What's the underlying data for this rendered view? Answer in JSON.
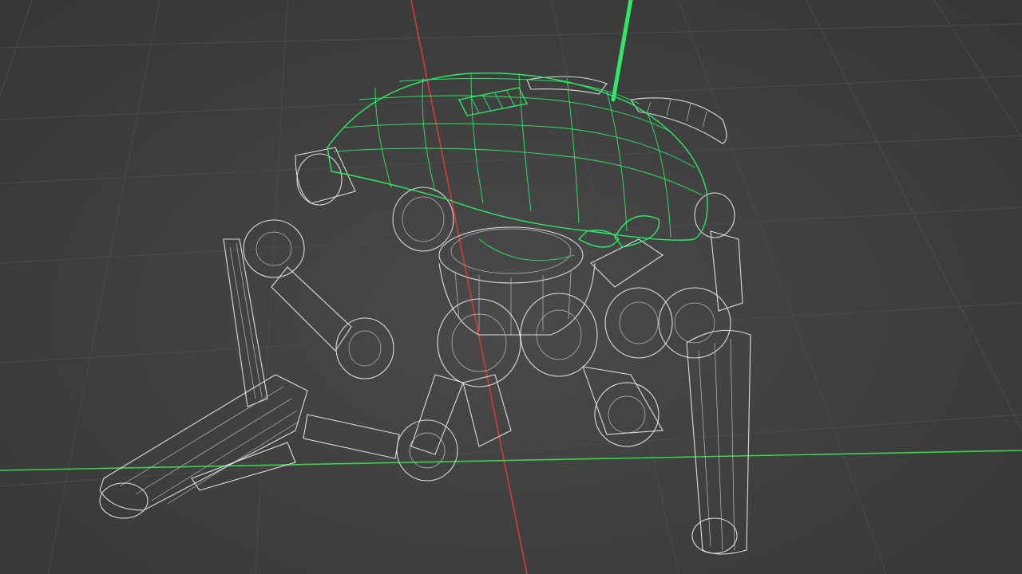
{
  "viewport": {
    "mode": "wireframe",
    "background_color": "#404040",
    "grid_color": "#4a4a4a",
    "x_axis_color": "#d33b3b",
    "y_axis_color": "#3bd447",
    "wire_color": "#dcdcdc",
    "selection_color": "#2fe866"
  },
  "scene": {
    "object": "spider-robot",
    "selected_part": "dome-shell"
  }
}
